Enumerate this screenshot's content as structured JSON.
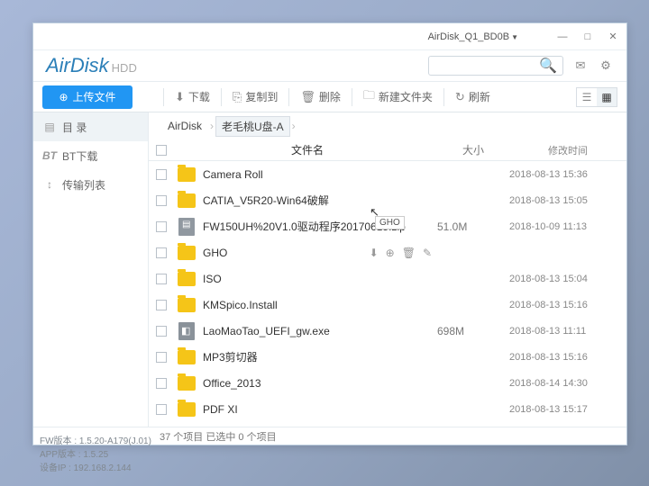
{
  "titlebar": {
    "device": "AirDisk_Q1_BD0B"
  },
  "header": {
    "logo": "AirDisk",
    "logo_sub": "HDD"
  },
  "toolbar": {
    "upload": "上传文件",
    "download": "下载",
    "copy_to": "复制到",
    "delete": "删除",
    "new_folder": "新建文件夹",
    "refresh": "刷新"
  },
  "sidebar": {
    "catalog": "目 录",
    "bt": "BT下载",
    "transfer": "传输列表"
  },
  "breadcrumb": {
    "root": "AirDisk",
    "current": "老毛桃U盘-A"
  },
  "columns": {
    "name": "文件名",
    "size": "大小",
    "modified": "修改时间"
  },
  "files": [
    {
      "type": "folder",
      "name": "Camera Roll",
      "size": "",
      "time": "2018-08-13 15:36"
    },
    {
      "type": "folder",
      "name": "CATIA_V5R20-Win64破解",
      "size": "",
      "time": "2018-08-13 15:05"
    },
    {
      "type": "zip",
      "name": "FW150UH%20V1.0驱动程序20170615.zip",
      "size": "51.0M",
      "time": "2018-10-09 11:13"
    },
    {
      "type": "folder",
      "name": "GHO",
      "size": "",
      "time": "",
      "hover": true
    },
    {
      "type": "folder",
      "name": "ISO",
      "size": "",
      "time": "2018-08-13 15:04"
    },
    {
      "type": "folder",
      "name": "KMSpico.Install",
      "size": "",
      "time": "2018-08-13 15:16"
    },
    {
      "type": "exe",
      "name": "LaoMaoTao_UEFI_gw.exe",
      "size": "698M",
      "time": "2018-08-13 11:11"
    },
    {
      "type": "folder",
      "name": "MP3剪切器",
      "size": "",
      "time": "2018-08-13 15:16"
    },
    {
      "type": "folder",
      "name": "Office_2013",
      "size": "",
      "time": "2018-08-14 14:30"
    },
    {
      "type": "folder",
      "name": "PDF XI",
      "size": "",
      "time": "2018-08-13 15:17"
    }
  ],
  "statusbar": "37 个项目 已选中 0 个项目",
  "tooltip": "GHO",
  "info": {
    "fw": "FW版本 : 1.5.20-A179(J.01)",
    "app": "APP版本 : 1.5.25",
    "ip": "设备IP : 192.168.2.144"
  }
}
